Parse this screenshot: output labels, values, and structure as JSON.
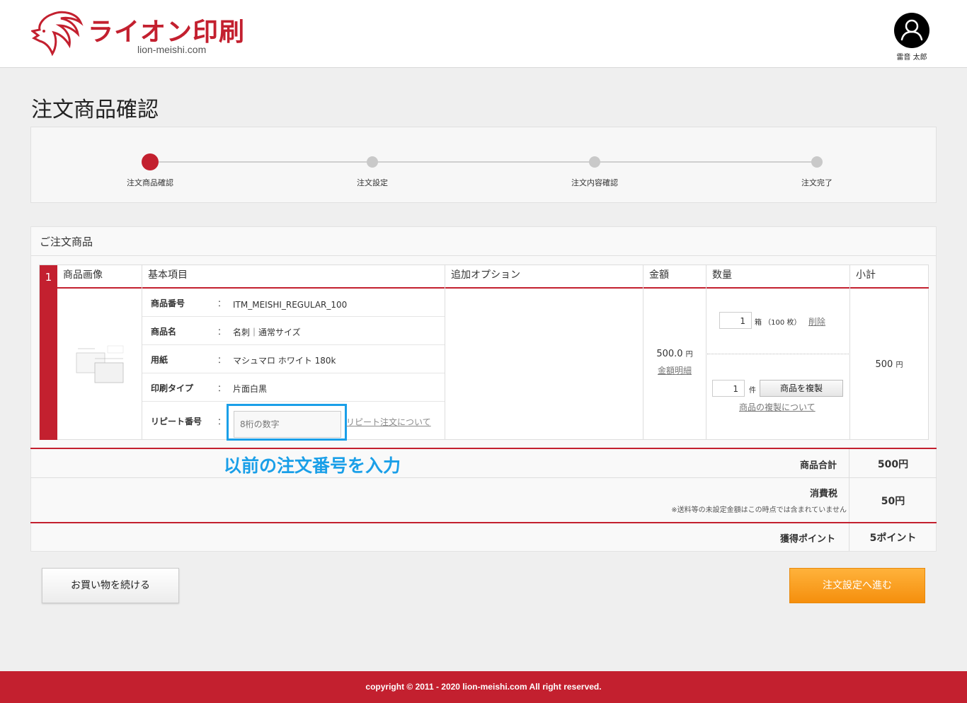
{
  "header": {
    "logo_text": "ライオン印刷",
    "logo_sub": "lion-meishi.com",
    "user_name": "雷音 太郎"
  },
  "page_title": "注文商品確認",
  "steps": [
    {
      "label": "注文商品確認",
      "active": true
    },
    {
      "label": "注文設定",
      "active": false
    },
    {
      "label": "注文内容確認",
      "active": false
    },
    {
      "label": "注文完了",
      "active": false
    }
  ],
  "panel": {
    "title": "ご注文商品",
    "columns": {
      "image": "商品画像",
      "basic": "基本項目",
      "option": "追加オプション",
      "price": "金額",
      "qty": "数量",
      "subtotal": "小計"
    },
    "item": {
      "index": "1",
      "colon": "：",
      "product_no_label": "商品番号",
      "product_no": "ITM_MEISHI_REGULAR_100",
      "product_name_label": "商品名",
      "product_name": "名刺｜通常サイズ",
      "paper_label": "用紙",
      "paper": "マシュマロ ホワイト 180k",
      "print_type_label": "印刷タイプ",
      "print_type": "片面白黒",
      "repeat_label": "リピート番号",
      "repeat_placeholder": "8桁の数字",
      "repeat_link": "リピート注文について",
      "price_value": "500.0",
      "price_unit": "円",
      "price_detail_link": "金額明細",
      "box_qty": "1",
      "box_unit": "箱 （100 枚）",
      "delete_link": "削除",
      "copy_qty": "1",
      "copy_unit": "件",
      "copy_button": "商品を複製",
      "copy_link": "商品の複製について",
      "subtotal_value": "500",
      "subtotal_unit": "円"
    }
  },
  "annotation": "以前の注文番号を入力",
  "summary": {
    "goods_total_label": "商品合計",
    "goods_total": "500円",
    "tax_label": "消費税",
    "tax_note": "※送料等の未設定金額はこの時点では含まれていません",
    "tax": "50円",
    "points_label": "獲得ポイント",
    "points": "5ポイント"
  },
  "buttons": {
    "continue": "お買い物を続ける",
    "next": "注文設定へ進む"
  },
  "footer": "copyright © 2011 - 2020 lion-meishi.com All right reserved.",
  "colors": {
    "brand_red": "#c3202f",
    "highlight_blue": "#1a9fe8",
    "next_orange": "#f5a020"
  }
}
